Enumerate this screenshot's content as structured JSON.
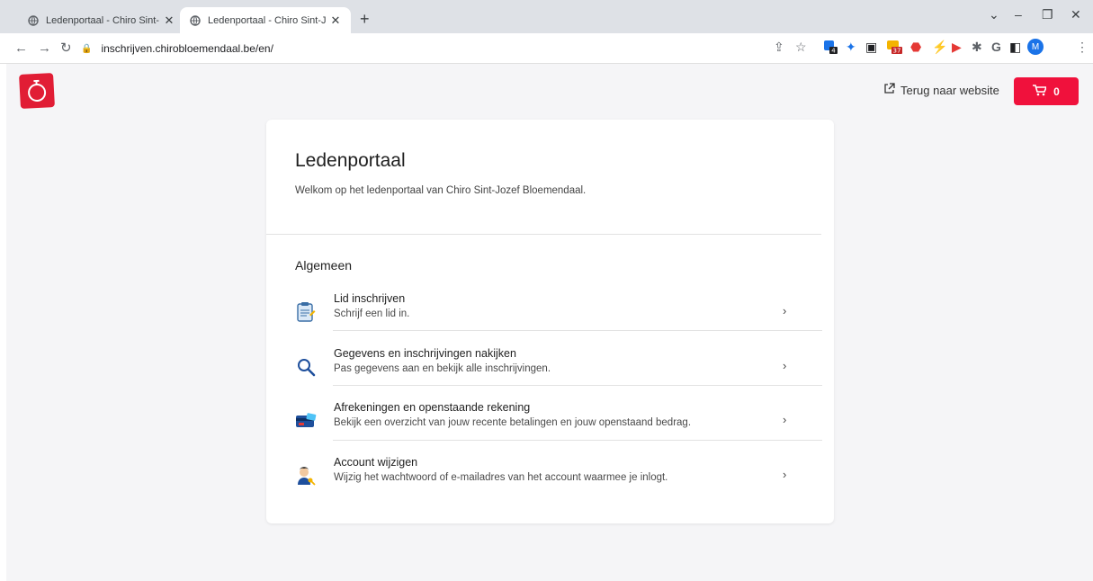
{
  "browser": {
    "tabs": [
      {
        "title": "Ledenportaal - Chiro Sint-Jozef B",
        "active": false
      },
      {
        "title": "Ledenportaal - Chiro Sint-Jozef B",
        "active": true
      }
    ],
    "new_tab": "+",
    "url": "inschrijven.chirobloemendaal.be/en/",
    "profile_initial": "M",
    "ext_badge_1": "4",
    "ext_badge_2": "37"
  },
  "header": {
    "back_link": "Terug naar website",
    "cart_count": "0",
    "accent": "#f0113c"
  },
  "portal": {
    "title": "Ledenportaal",
    "subtitle": "Welkom op het ledenportaal van Chiro Sint-Jozef Bloemendaal.",
    "section": "Algemeen",
    "items": [
      {
        "title": "Lid inschrijven",
        "desc": "Schrijf een lid in.",
        "icon": "clipboard-icon"
      },
      {
        "title": "Gegevens en inschrijvingen nakijken",
        "desc": "Pas gegevens aan en bekijk alle inschrijvingen.",
        "icon": "magnifier-icon"
      },
      {
        "title": "Afrekeningen en openstaande rekening",
        "desc": "Bekijk een overzicht van jouw recente betalingen en jouw openstaand bedrag.",
        "icon": "credit-card-icon"
      },
      {
        "title": "Account wijzigen",
        "desc": "Wijzig het wachtwoord of e-mailadres van het account waarmee je inlogt.",
        "icon": "person-key-icon"
      }
    ]
  }
}
